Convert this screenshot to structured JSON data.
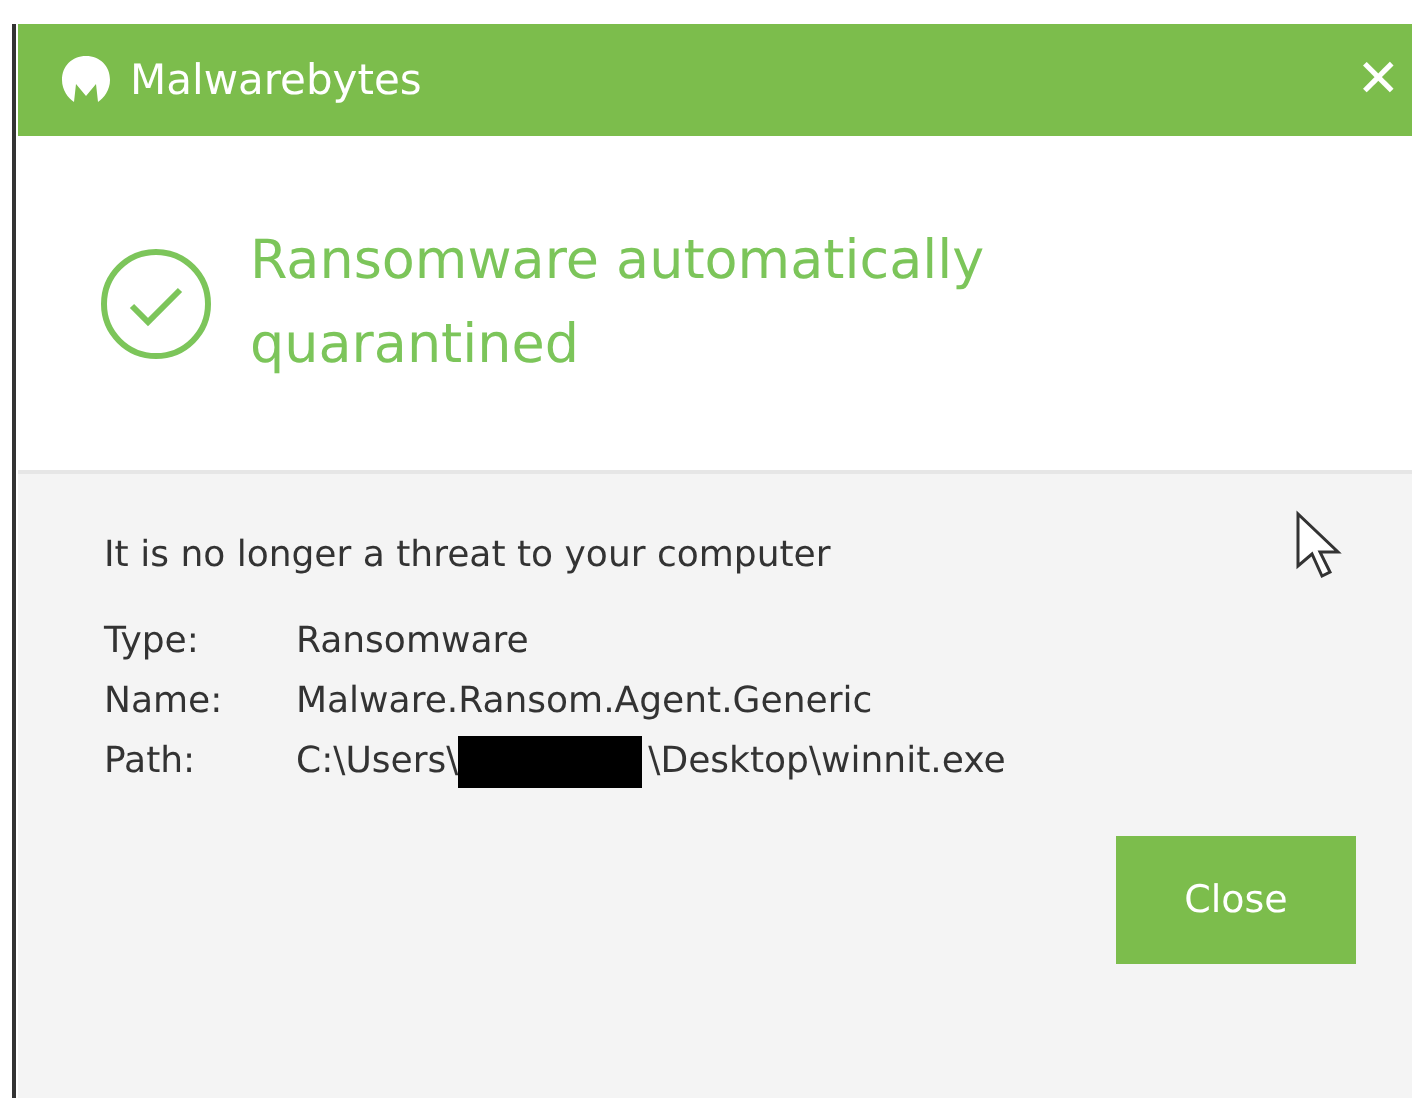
{
  "window": {
    "title": "Malwarebytes",
    "close": "✕"
  },
  "status": {
    "heading": "Ransomware automatically quarantined"
  },
  "message": "It is no longer a threat to your computer",
  "details": [
    {
      "label": "Type:",
      "value": "Ransomware"
    },
    {
      "label": "Name:",
      "value": "Malware.Ransom.Agent.Generic"
    },
    {
      "label": "Path:",
      "value": "C:\\Users\\",
      "value_after": "\\Desktop\\winnit.exe"
    }
  ],
  "buttons": [
    "Close"
  ]
}
